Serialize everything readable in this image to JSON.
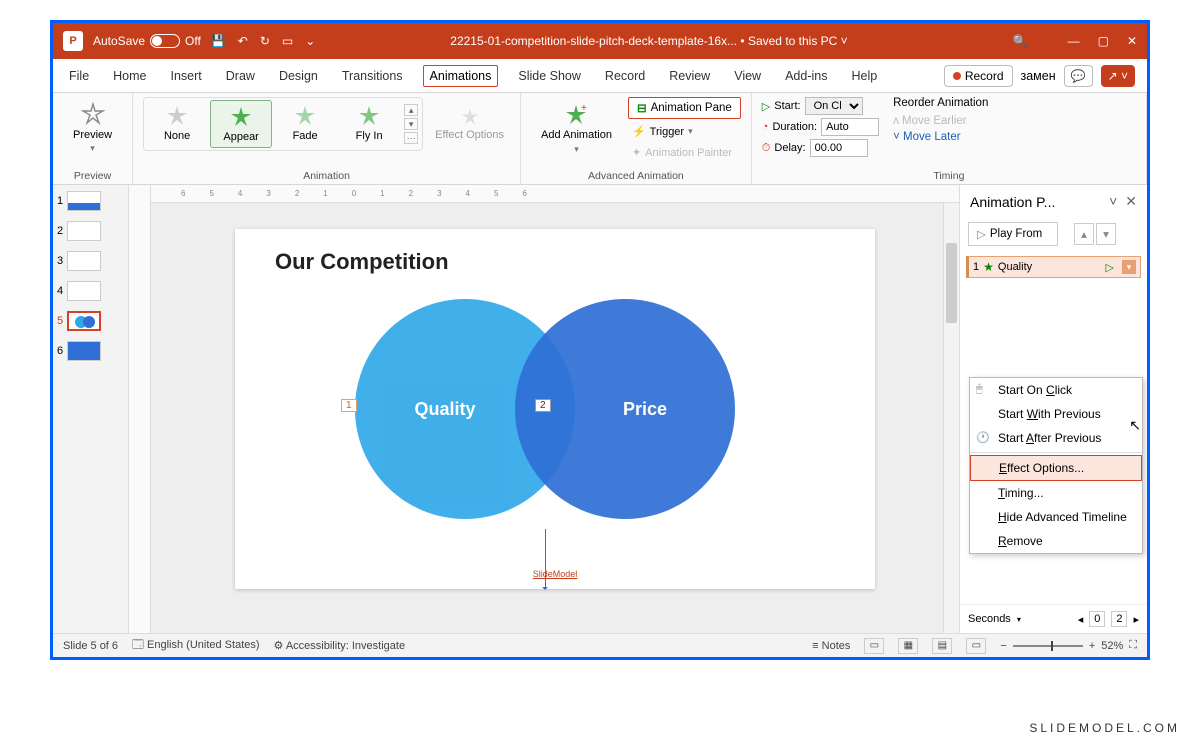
{
  "titlebar": {
    "autosave_label": "AutoSave",
    "autosave_state": "Off",
    "doc_title": "22215-01-competition-slide-pitch-deck-template-16x... • Saved to this PC ˅"
  },
  "tabs": {
    "file": "File",
    "home": "Home",
    "insert": "Insert",
    "draw": "Draw",
    "design": "Design",
    "transitions": "Transitions",
    "animations": "Animations",
    "slideshow": "Slide Show",
    "record_tab": "Record",
    "review": "Review",
    "view": "View",
    "addins": "Add-ins",
    "help": "Help",
    "record_btn": "Record"
  },
  "ribbon": {
    "preview": "Preview",
    "preview_group": "Preview",
    "anim_none": "None",
    "anim_appear": "Appear",
    "anim_fade": "Fade",
    "anim_flyin": "Fly In",
    "effect_options": "Effect Options",
    "animation_group": "Animation",
    "add_animation": "Add Animation",
    "animation_pane": "Animation Pane",
    "trigger": "Trigger",
    "animation_painter": "Animation Painter",
    "adv_group": "Advanced Animation",
    "start_label": "Start:",
    "start_value": "On Click",
    "duration_label": "Duration:",
    "duration_value": "Auto",
    "delay_label": "Delay:",
    "delay_value": "00.00",
    "reorder": "Reorder Animation",
    "move_earlier": "Move Earlier",
    "move_later": "Move Later",
    "timing_group": "Timing"
  },
  "thumbs": [
    "1",
    "2",
    "3",
    "4",
    "5",
    "6"
  ],
  "slide": {
    "title": "Our Competition",
    "left_label": "Quality",
    "right_label": "Price",
    "tag1": "1",
    "tag2": "2",
    "footer": "SlideModel"
  },
  "anim_pane": {
    "title": "Animation P...",
    "play": "Play From",
    "item_num": "1",
    "item_name": "Quality",
    "seconds": "Seconds",
    "range_a": "0",
    "range_b": "2"
  },
  "ctx": {
    "start_on_click": "Start On Click",
    "start_with_prev": "Start With Previous",
    "start_after_prev": "Start After Previous",
    "effect_options": "Effect Options...",
    "timing": "Timing...",
    "hide_timeline": "Hide Advanced Timeline",
    "remove": "Remove"
  },
  "status": {
    "slide_indicator": "Slide 5 of 6",
    "language": "English (United States)",
    "accessibility": "Accessibility: Investigate",
    "notes": "Notes",
    "zoom": "52%"
  },
  "watermark": "SLIDEMODEL.COM"
}
